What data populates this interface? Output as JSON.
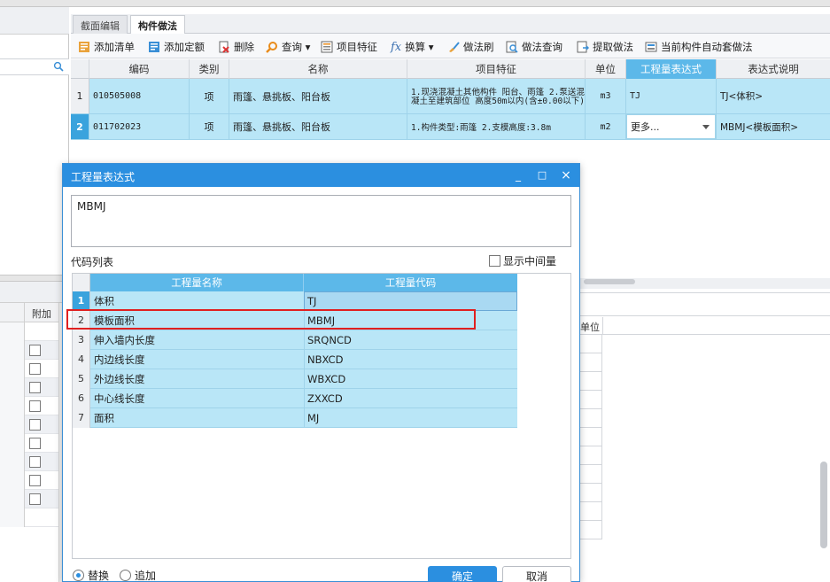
{
  "tabs": [
    {
      "label": "截面编辑"
    },
    {
      "label": "构件做法"
    }
  ],
  "toolbar": {
    "add_list": "添加清单",
    "add_quota": "添加定额",
    "delete": "删除",
    "query": "查询",
    "item_feature": "项目特征",
    "convert": "换算",
    "method_brush": "做法刷",
    "method_query": "做法查询",
    "extract": "提取做法",
    "auto_method": "当前构件自动套做法",
    "fx": "fx"
  },
  "grid": {
    "headers": [
      "编码",
      "类别",
      "名称",
      "项目特征",
      "单位",
      "工程量表达式",
      "表达式说明"
    ],
    "rows": [
      {
        "num": "1",
        "code": "010505008",
        "type": "项",
        "name": "雨篷、悬挑板、阳台板",
        "feature": "1.现浇混凝土其他构件 阳台、雨篷 2.泵送混凝土至建筑部位 高度50m以内(含±0.00以下)",
        "unit": "m3",
        "expr": "TJ",
        "desc": "TJ<体积>"
      },
      {
        "num": "2",
        "code": "011702023",
        "type": "项",
        "name": "雨篷、悬挑板、阳台板",
        "feature": "1.构件类型:雨篷 2.支模高度:3.8m",
        "unit": "m2",
        "expr": "更多...",
        "desc": "MBMJ<模板面积>"
      }
    ]
  },
  "left_panel": {
    "attach_label": "附加",
    "row_count": 11
  },
  "lower_panel": {
    "unit_label": "单位"
  },
  "dialog": {
    "title": "工程量表达式",
    "expression": "MBMJ",
    "code_list_label": "代码列表",
    "show_mid_label": "显示中间量",
    "col_name": "工程量名称",
    "col_code": "工程量代码",
    "items": [
      {
        "num": "1",
        "name": "体积",
        "code": "TJ"
      },
      {
        "num": "2",
        "name": "模板面积",
        "code": "MBMJ"
      },
      {
        "num": "3",
        "name": "伸入墙内长度",
        "code": "SRQNCD"
      },
      {
        "num": "4",
        "name": "内边线长度",
        "code": "NBXCD"
      },
      {
        "num": "5",
        "name": "外边线长度",
        "code": "WBXCD"
      },
      {
        "num": "6",
        "name": "中心线长度",
        "code": "ZXXCD"
      },
      {
        "num": "7",
        "name": "面积",
        "code": "MJ"
      }
    ],
    "radio_replace": "替换",
    "radio_append": "追加",
    "ok": "确定",
    "cancel": "取消",
    "minimize": "_",
    "maximize": "□",
    "close": "×"
  },
  "colors": {
    "title_blue": "#2b8fe0",
    "header_blue": "#5cb8e9",
    "row_blue": "#b9e6f7",
    "highlight_red": "#e02020"
  }
}
